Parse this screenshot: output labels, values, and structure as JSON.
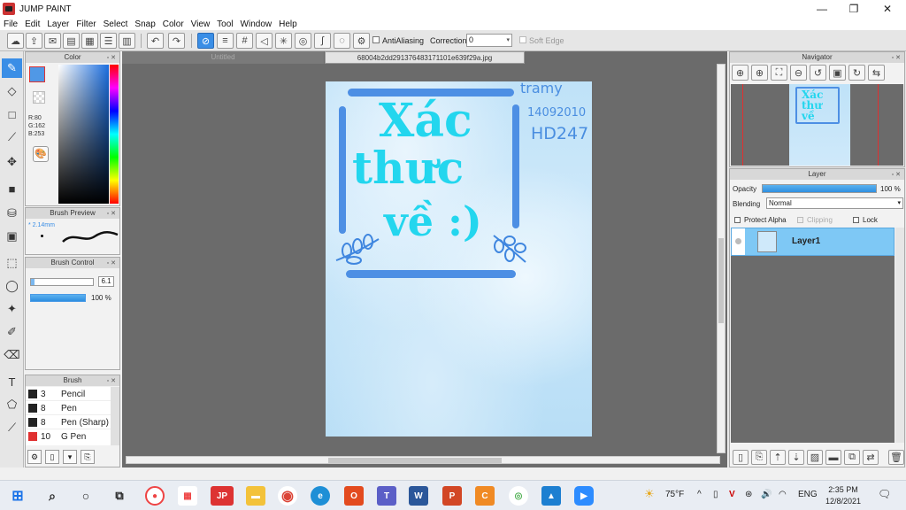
{
  "window": {
    "title": "JUMP PAINT"
  },
  "menu": [
    "File",
    "Edit",
    "Layer",
    "Filter",
    "Select",
    "Snap",
    "Color",
    "View",
    "Tool",
    "Window",
    "Help"
  ],
  "toolbar": {
    "antialiasing_label": "AntiAliasing",
    "correction_label": "Correction",
    "correction_value": "0",
    "soft_edge_label": "Soft Edge"
  },
  "color_panel": {
    "title": "Color",
    "r": "R:80",
    "g": "G:162",
    "b": "B:253",
    "current_color": "#5098e6"
  },
  "brush_preview": {
    "title": "Brush Preview",
    "size": "2.14mm"
  },
  "brush_control": {
    "title": "Brush Control",
    "size_value": "6.1",
    "opacity_value": "100 %"
  },
  "brush_list": {
    "title": "Brush",
    "items": [
      {
        "size": "3",
        "name": "Pencil",
        "color": "#222222"
      },
      {
        "size": "8",
        "name": "Pen",
        "color": "#222222"
      },
      {
        "size": "8",
        "name": "Pen (Sharp)",
        "color": "#222222"
      },
      {
        "size": "10",
        "name": "G Pen",
        "color": "#e03030"
      }
    ]
  },
  "tabs": {
    "untitled": "Untitled",
    "active": "68004b2dd291376483171101e639f29a.jpg"
  },
  "artwork": {
    "line1": "Xác",
    "line2": "thưc",
    "line3": "về :)",
    "note_name": "tramy",
    "note_date": "14092010",
    "note_code": "HD247"
  },
  "navigator": {
    "title": "Navigator"
  },
  "layer_panel": {
    "title": "Layer",
    "opacity_label": "Opacity",
    "opacity_value": "100 %",
    "opacity_level": 1.0,
    "blending_label": "Blending",
    "blending_value": "Normal",
    "protect_alpha": "Protect Alpha",
    "clipping": "Clipping",
    "lock": "Lock",
    "layers": [
      {
        "name": "Layer1"
      }
    ]
  },
  "taskbar": {
    "weather": "75°F",
    "language": "ENG",
    "time": "2:35 PM",
    "date": "12/8/2021"
  }
}
